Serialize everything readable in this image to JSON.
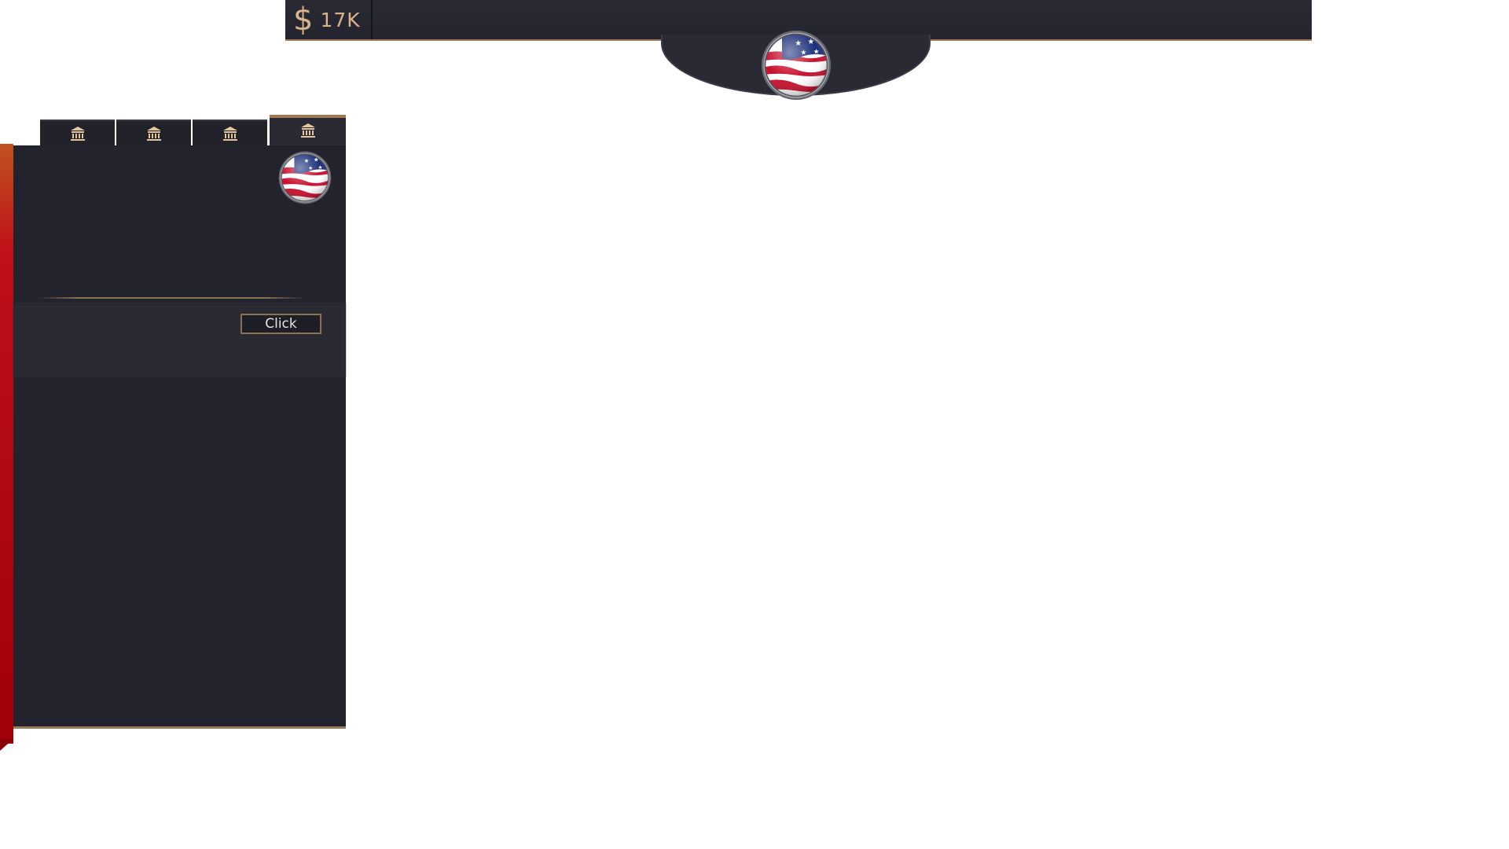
{
  "topbar": {
    "currency_symbol": "$",
    "money_amount": "17K",
    "nation_flag_icon": "usa-flag-icon"
  },
  "sidebar": {
    "tabs": [
      {
        "icon": "bank-icon",
        "active": false
      },
      {
        "icon": "bank-icon",
        "active": false
      },
      {
        "icon": "bank-icon",
        "active": false
      },
      {
        "icon": "bank-icon",
        "active": true
      }
    ],
    "panel_flag_icon": "usa-flag-icon",
    "click_label": "Click"
  },
  "colors": {
    "bar_background": "#2a2a35",
    "panel_background": "#23232d",
    "gold_accent": "#d7b48b",
    "bronze_border": "#9a7a58",
    "red_accent": "#c0101a"
  }
}
